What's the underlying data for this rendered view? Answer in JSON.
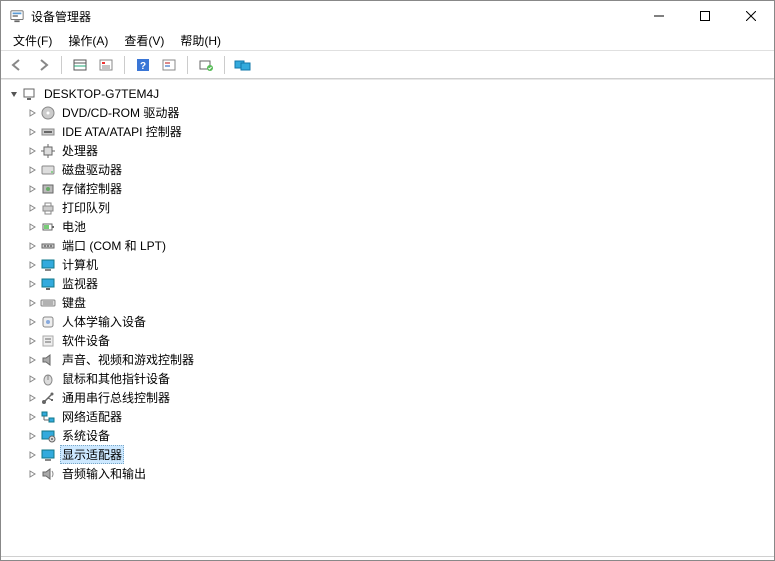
{
  "window": {
    "title": "设备管理器"
  },
  "menu": {
    "file": "文件(F)",
    "action": "操作(A)",
    "view": "查看(V)",
    "help": "帮助(H)"
  },
  "toolbar": {
    "back": "back",
    "forward": "forward",
    "up": "view-detail",
    "properties": "properties",
    "help": "help",
    "refresh": "refresh",
    "scan": "scan-hardware",
    "monitors": "monitors"
  },
  "tree": {
    "root": {
      "label": "DESKTOP-G7TEM4J"
    },
    "items": [
      {
        "label": "DVD/CD-ROM 驱动器",
        "icon": "disc"
      },
      {
        "label": "IDE ATA/ATAPI 控制器",
        "icon": "ide"
      },
      {
        "label": "处理器",
        "icon": "cpu"
      },
      {
        "label": "磁盘驱动器",
        "icon": "disk"
      },
      {
        "label": "存储控制器",
        "icon": "storage"
      },
      {
        "label": "打印队列",
        "icon": "printer"
      },
      {
        "label": "电池",
        "icon": "battery"
      },
      {
        "label": "端口 (COM 和 LPT)",
        "icon": "port"
      },
      {
        "label": "计算机",
        "icon": "computer"
      },
      {
        "label": "监视器",
        "icon": "monitor"
      },
      {
        "label": "键盘",
        "icon": "keyboard"
      },
      {
        "label": "人体学输入设备",
        "icon": "hid"
      },
      {
        "label": "软件设备",
        "icon": "software"
      },
      {
        "label": "声音、视频和游戏控制器",
        "icon": "sound"
      },
      {
        "label": "鼠标和其他指针设备",
        "icon": "mouse"
      },
      {
        "label": "通用串行总线控制器",
        "icon": "usb"
      },
      {
        "label": "网络适配器",
        "icon": "network"
      },
      {
        "label": "系统设备",
        "icon": "system"
      },
      {
        "label": "显示适配器",
        "icon": "display",
        "selected": true
      },
      {
        "label": "音频输入和输出",
        "icon": "audio"
      }
    ]
  }
}
